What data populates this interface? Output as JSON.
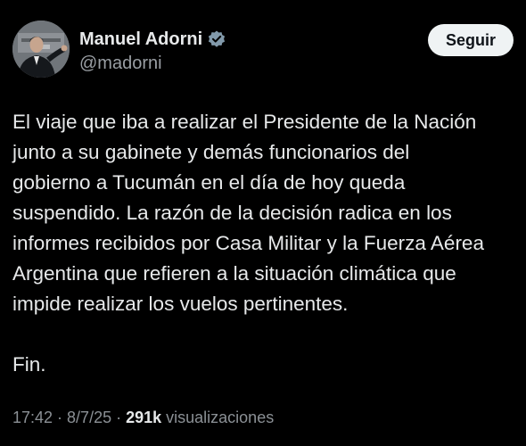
{
  "author": {
    "display_name": "Manuel Adorni",
    "handle": "@madorni",
    "verified": true,
    "avatar_icon": "profile-photo"
  },
  "actions": {
    "follow_label": "Seguir"
  },
  "tweet": {
    "paragraphs": [
      "El viaje que iba a realizar el Presidente de la Nación\njunto a su gabinete y demás funcionarios del\ngobierno a Tucumán en el día de hoy queda\nsuspendido. La razón de la decisión radica en los\ninformes recibidos por Casa Militar y la Fuerza Aérea\nArgentina que refieren a la situación climática que\nimpide realizar los vuelos pertinentes.",
      "Fin."
    ]
  },
  "meta": {
    "time": "17:42",
    "separator_1": " · ",
    "date": "8/7/25",
    "separator_2": " · ",
    "views_count": "291k",
    "views_label": " visualizaciones"
  },
  "colors": {
    "background": "#000000",
    "text_primary": "#e7e9ea",
    "text_secondary": "#8b9095",
    "verified_badge": "#829aab",
    "button_bg": "#eff3f4"
  }
}
